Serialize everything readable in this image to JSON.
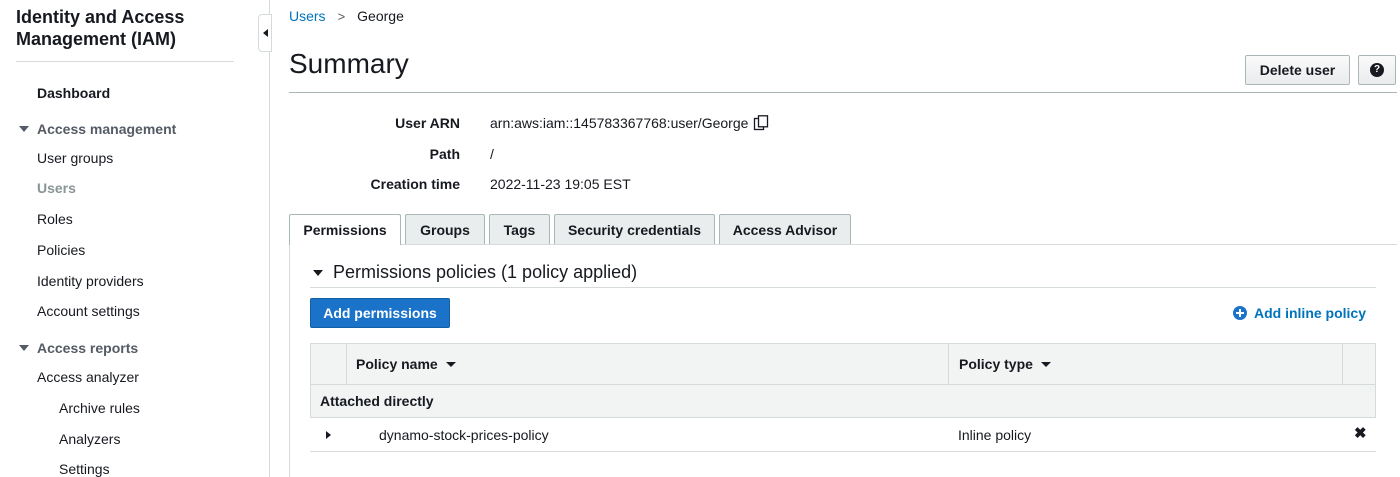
{
  "sidebar": {
    "title": "Identity and Access Management (IAM)",
    "dashboard": "Dashboard",
    "access_management": {
      "label": "Access management",
      "items": [
        "User groups",
        "Users",
        "Roles",
        "Policies",
        "Identity providers",
        "Account settings"
      ],
      "active": "Users"
    },
    "access_reports": {
      "label": "Access reports",
      "items": [
        "Access analyzer"
      ],
      "subitems": [
        "Archive rules",
        "Analyzers",
        "Settings"
      ]
    }
  },
  "breadcrumb": {
    "parent": "Users",
    "current": "George"
  },
  "page": {
    "title": "Summary",
    "delete_label": "Delete user",
    "help_glyph": "?"
  },
  "summary": {
    "user_arn_label": "User ARN",
    "user_arn": "arn:aws:iam::145783367768:user/George",
    "path_label": "Path",
    "path": "/",
    "creation_label": "Creation time",
    "creation_time": "2022-11-23 19:05 EST"
  },
  "tabs": [
    "Permissions",
    "Groups",
    "Tags",
    "Security credentials",
    "Access Advisor"
  ],
  "active_tab": "Permissions",
  "permissions": {
    "header": "Permissions policies (1 policy applied)",
    "add_permissions": "Add permissions",
    "add_inline": "Add inline policy",
    "columns": [
      "Policy name",
      "Policy type"
    ],
    "group_label": "Attached directly",
    "rows": [
      {
        "name": "dynamo-stock-prices-policy",
        "type": "Inline policy"
      }
    ],
    "remove_glyph": "✖"
  },
  "colors": {
    "link": "#0073bb",
    "primary_button": "#1a73c9"
  }
}
